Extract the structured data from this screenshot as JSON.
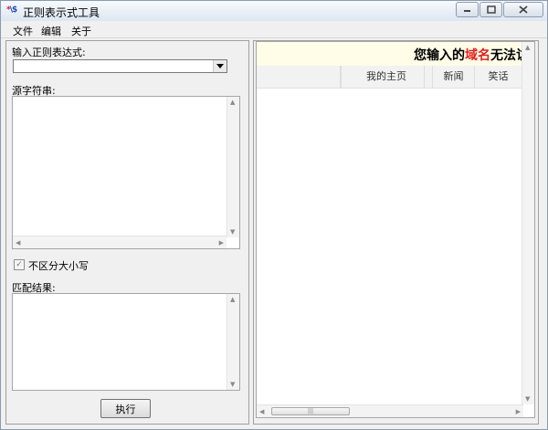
{
  "window": {
    "title": "正则表示式工具",
    "icon_text_a": "*",
    "icon_text_b": "\\$"
  },
  "menu": {
    "items": [
      "文件",
      "编辑",
      "关于"
    ]
  },
  "left": {
    "regex_label": "输入正则表达式:",
    "regex_value": "",
    "source_label": "源字符串:",
    "source_value": "",
    "case_label": "不区分大小写",
    "case_checked": true,
    "result_label": "匹配结果:",
    "result_value": "",
    "run_button": "执行"
  },
  "browser": {
    "banner_prefix": "您输入的",
    "banner_highlight": "域名",
    "banner_suffix": "无法访问",
    "nav": [
      "我的主页",
      "新闻",
      "笑话"
    ],
    "highlight_color": "#e02020"
  },
  "icons": {
    "minimize": "minimize-icon",
    "maximize": "maximize-icon",
    "close": "close-icon",
    "dropdown": "chevron-down-icon"
  }
}
